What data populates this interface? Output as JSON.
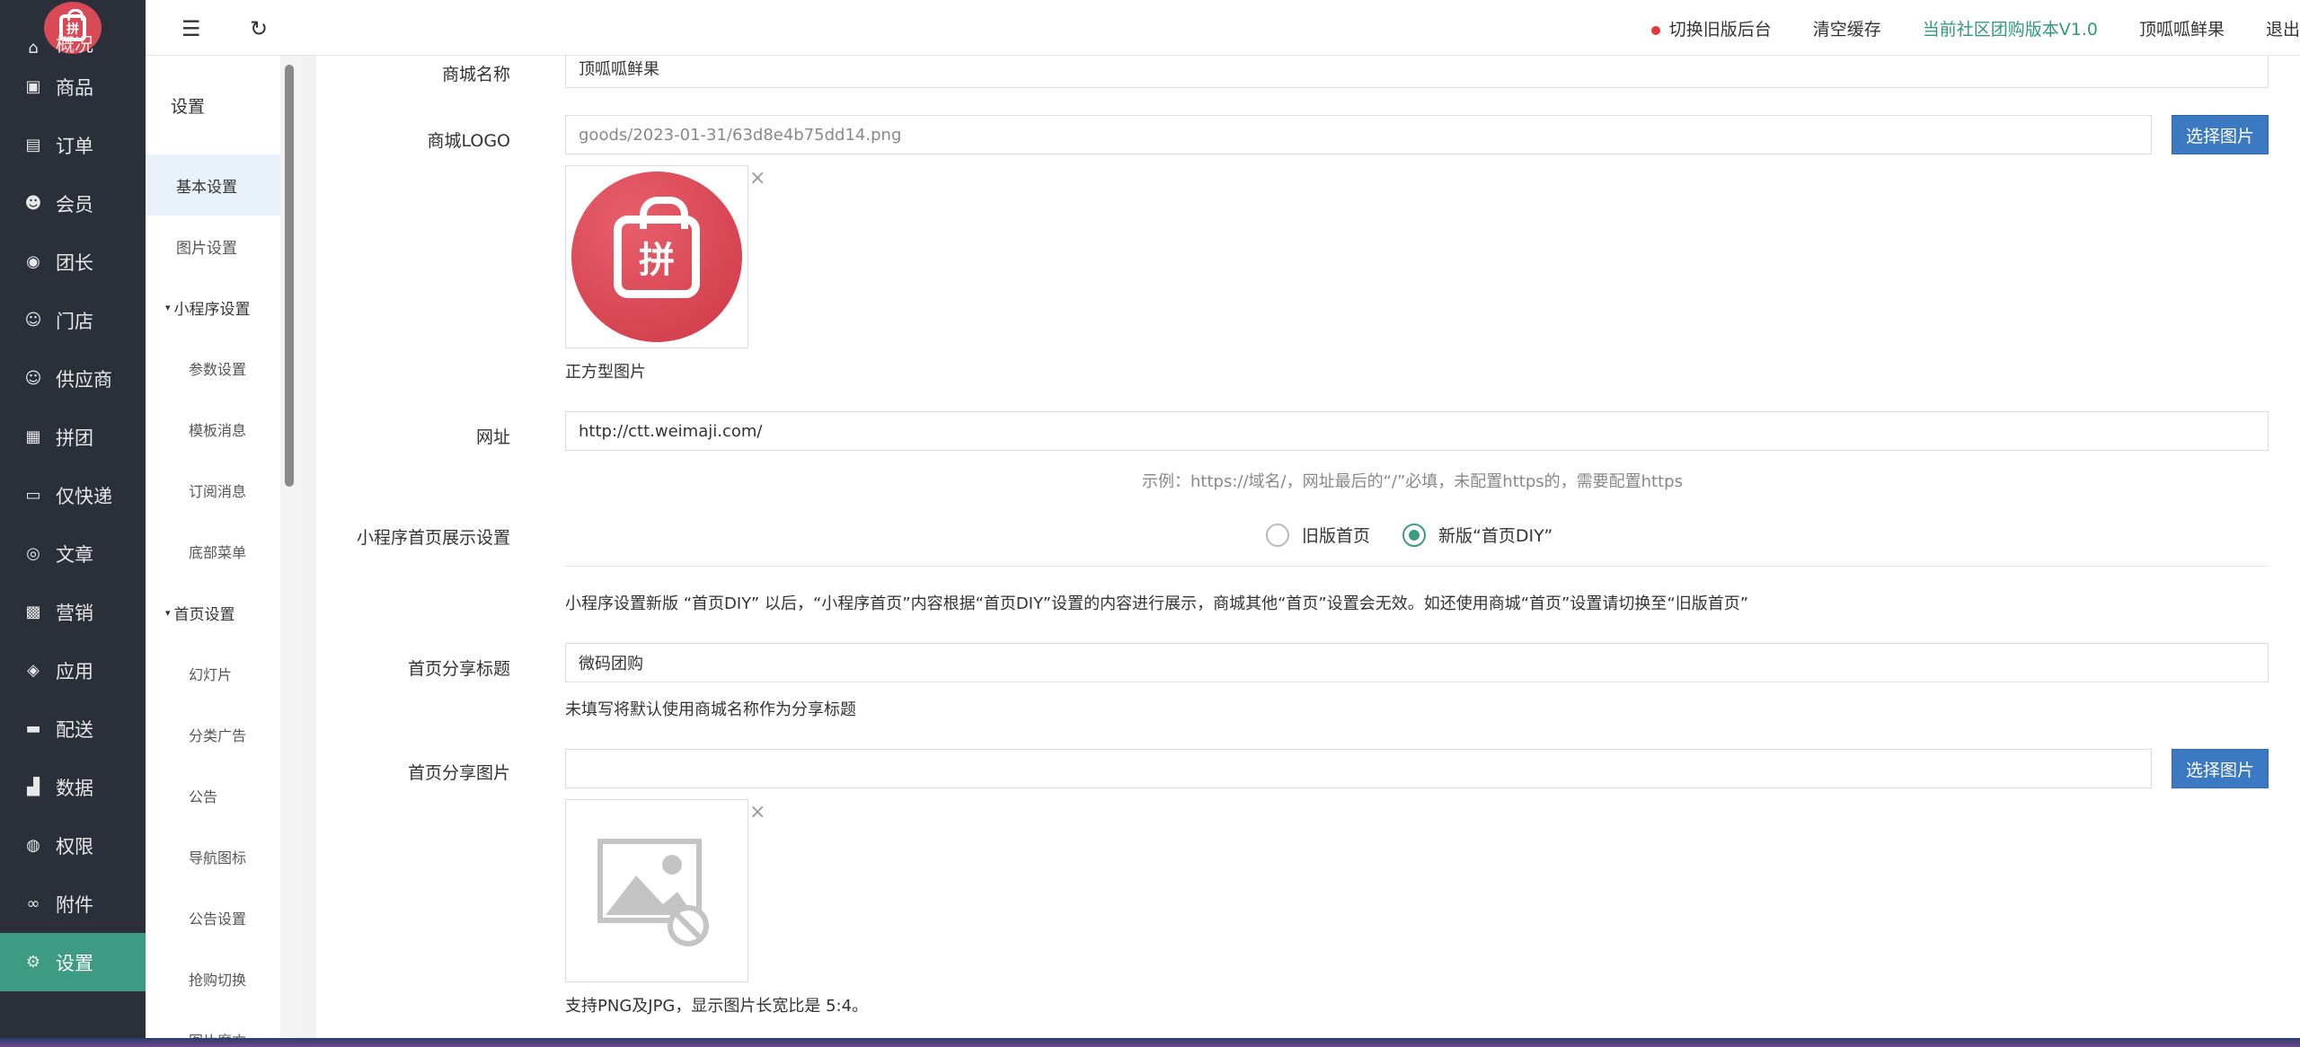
{
  "nav": {
    "logo_char": "拼",
    "items": [
      {
        "label": "概况",
        "icon": "home-icon",
        "glyph": "⌂"
      },
      {
        "label": "商品",
        "icon": "shopping-bag-icon",
        "glyph": "▣"
      },
      {
        "label": "订单",
        "icon": "document-icon",
        "glyph": "▤"
      },
      {
        "label": "会员",
        "icon": "users-icon",
        "glyph": "☻"
      },
      {
        "label": "团长",
        "icon": "crown-icon",
        "glyph": "◉"
      },
      {
        "label": "门店",
        "icon": "store-user-icon",
        "glyph": "☺"
      },
      {
        "label": "供应商",
        "icon": "supplier-icon",
        "glyph": "☺"
      },
      {
        "label": "拼团",
        "icon": "group-buy-icon",
        "glyph": "▦"
      },
      {
        "label": "仅快递",
        "icon": "express-icon",
        "glyph": "▭"
      },
      {
        "label": "文章",
        "icon": "compass-icon",
        "glyph": "◎"
      },
      {
        "label": "营销",
        "icon": "gift-icon",
        "glyph": "▩"
      },
      {
        "label": "应用",
        "icon": "cube-icon",
        "glyph": "◈"
      },
      {
        "label": "配送",
        "icon": "truck-icon",
        "glyph": "▬"
      },
      {
        "label": "数据",
        "icon": "chart-icon",
        "glyph": "▟"
      },
      {
        "label": "权限",
        "icon": "lock-icon",
        "glyph": "◍"
      },
      {
        "label": "附件",
        "icon": "link-icon",
        "glyph": "∞"
      },
      {
        "label": "设置",
        "icon": "gear-icon",
        "glyph": "⚙"
      }
    ]
  },
  "topbar": {
    "switch_old": "切换旧版后台",
    "clear_cache": "清空缓存",
    "version": "当前社区团购版本V1.0",
    "shop_name": "顶呱呱鲜果",
    "logout": "退出"
  },
  "submenu": {
    "title": "设置",
    "items": [
      {
        "label": "基本设置"
      },
      {
        "label": "图片设置"
      },
      {
        "label": "小程序设置"
      },
      {
        "label": "参数设置"
      },
      {
        "label": "模板消息"
      },
      {
        "label": "订阅消息"
      },
      {
        "label": "底部菜单"
      },
      {
        "label": "首页设置"
      },
      {
        "label": "幻灯片"
      },
      {
        "label": "分类广告"
      },
      {
        "label": "公告"
      },
      {
        "label": "导航图标"
      },
      {
        "label": "公告设置"
      },
      {
        "label": "抢购切换"
      },
      {
        "label": "图片魔方"
      }
    ]
  },
  "form": {
    "shop_name_label": "商城名称",
    "shop_name_value": "顶呱呱鲜果",
    "logo_label": "商城LOGO",
    "logo_path": "goods/2023-01-31/63d8e4b75dd14.png",
    "pick_image": "选择图片",
    "logo_close": "×",
    "logo_hint": "正方型图片",
    "url_label": "网址",
    "url_value": "http://ctt.weimaji.com/",
    "url_hint": "示例：https://域名/，网址最后的“/”必填，未配置https的，需要配置https",
    "home_display_label": "小程序首页展示设置",
    "radio_old": "旧版首页",
    "radio_new": "新版“首页DIY”",
    "home_display_note": "小程序设置新版 “首页DIY” 以后，“小程序首页”内容根据“首页DIY”设置的内容进行展示，商城其他“首页”设置会无效。如还使用商城“首页”设置请切换至“旧版首页”",
    "share_title_label": "首页分享标题",
    "share_title_value": "微码团购",
    "share_title_hint": "未填写将默认使用商城名称作为分享标题",
    "share_image_label": "首页分享图片",
    "share_image_value": "",
    "share_close": "×",
    "share_image_hint": "支持PNG及JPG，显示图片长宽比是 5:4。"
  }
}
